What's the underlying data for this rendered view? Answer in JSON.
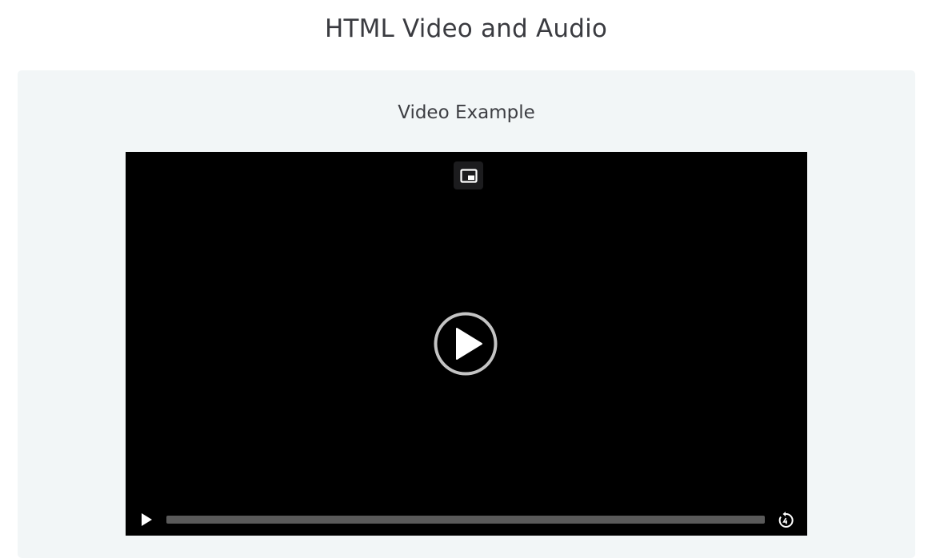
{
  "page": {
    "title": "HTML Video and Audio"
  },
  "video_section": {
    "title": "Video Example",
    "player": {
      "progress": 0,
      "pip_icon": "picture-in-picture-icon",
      "big_play_icon": "play-circle-icon",
      "play_icon": "play-icon",
      "skip_icon": "skip-back-icon"
    }
  },
  "colors": {
    "panel_bg": "#f2f6f7",
    "video_bg": "#000000",
    "text": "#3a3b40"
  }
}
